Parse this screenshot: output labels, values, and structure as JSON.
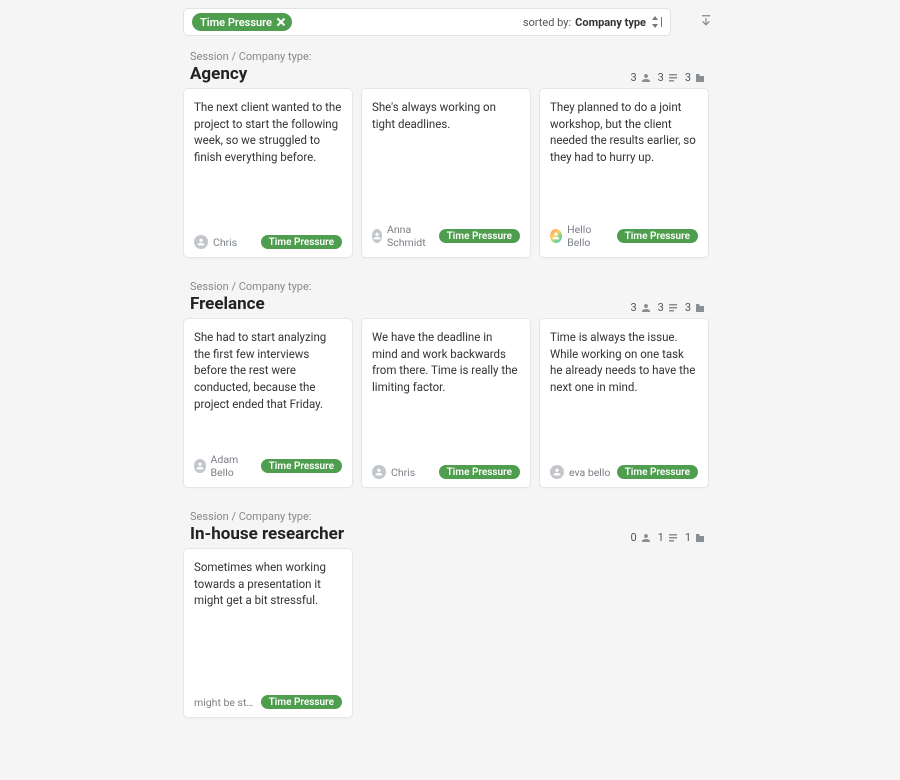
{
  "toolbar": {
    "filter_tag": "Time Pressure",
    "sorted_by_label": "sorted by:",
    "sorted_by_value": "Company type"
  },
  "group_header_prefix": "Session / Company type:",
  "groups": [
    {
      "title": "Agency",
      "stats": {
        "participants": 3,
        "notes": 3,
        "files": 3
      },
      "cards": [
        {
          "text": "The next client wanted to the project to start the following week, so we struggled to finish everything before.",
          "author": "Chris",
          "avatar": "plain",
          "tag": "Time Pressure"
        },
        {
          "text": "She's always working on tight deadlines.",
          "author": "Anna Schmidt",
          "avatar": "plain",
          "tag": "Time Pressure"
        },
        {
          "text": "They planned to do a joint workshop, but the client needed the results earlier, so they had to hurry up.",
          "author": "Hello Bello",
          "avatar": "colored",
          "tag": "Time Pressure"
        }
      ]
    },
    {
      "title": "Freelance",
      "stats": {
        "participants": 3,
        "notes": 3,
        "files": 3
      },
      "cards": [
        {
          "text": "She had to start analyzing the first few interviews before the rest were conducted, because the project ended that Friday.",
          "author": "Adam Bello",
          "avatar": "plain",
          "tag": "Time Pressure"
        },
        {
          "text": "We have the deadline in mind and work backwards from there. Time is really the limiting factor.",
          "author": "Chris",
          "avatar": "plain",
          "tag": "Time Pressure"
        },
        {
          "text": "Time is always the issue. While working on one task he already needs to have the next one in mind.",
          "author": "eva bello",
          "avatar": "plain",
          "tag": "Time Pressure"
        }
      ]
    },
    {
      "title": "In-house researcher",
      "stats": {
        "participants": 0,
        "notes": 1,
        "files": 1
      },
      "cards": [
        {
          "text": "Sometimes when working towards a presentation it might get a bit stressful.",
          "footer_note": "might be stressful",
          "tag": "Time Pressure"
        }
      ]
    }
  ]
}
